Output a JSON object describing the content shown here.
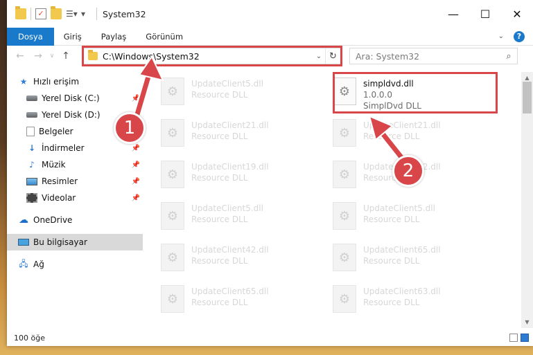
{
  "window": {
    "title": "System32",
    "controls": {
      "minimize": "—",
      "maximize": "☐",
      "close": "✕"
    }
  },
  "ribbon": {
    "tabs": [
      "Dosya",
      "Giriş",
      "Paylaş",
      "Görünüm"
    ],
    "help": "?"
  },
  "nav": {
    "address": "C:\\Windows\\System32",
    "search_placeholder": "Ara: System32"
  },
  "sidebar": {
    "items": [
      {
        "label": "Hızlı erişim",
        "icon": "star-icon"
      },
      {
        "label": "Yerel Disk (C:)",
        "icon": "disk-icon"
      },
      {
        "label": "Yerel Disk (D:)",
        "icon": "disk-icon"
      },
      {
        "label": "Belgeler",
        "icon": "documents-icon"
      },
      {
        "label": "İndirmeler",
        "icon": "downloads-icon"
      },
      {
        "label": "Müzik",
        "icon": "music-icon"
      },
      {
        "label": "Resimler",
        "icon": "pictures-icon"
      },
      {
        "label": "Videolar",
        "icon": "videos-icon"
      },
      {
        "label": "OneDrive",
        "icon": "cloud-icon"
      },
      {
        "label": "Bu bilgisayar",
        "icon": "computer-icon"
      },
      {
        "label": "Ağ",
        "icon": "network-icon"
      }
    ]
  },
  "files": [
    {
      "name": "UpdateClient5.dll",
      "sub": "Resource DLL"
    },
    {
      "name": "simpldvd.dll",
      "sub": "1.0.0.0",
      "sub2": "SimplDvd DLL"
    },
    {
      "name": "UpdateClient21.dll",
      "sub": "Resource DLL"
    },
    {
      "name": "UpdateClient21.dll",
      "sub": "Resource DLL"
    },
    {
      "name": "UpdateClient19.dll",
      "sub": "Resource DLL"
    },
    {
      "name": "UpdateClient42.dll",
      "sub": "Resource DLL"
    },
    {
      "name": "UpdateClient5.dll",
      "sub": "Resource DLL"
    },
    {
      "name": "UpdateClient5.dll",
      "sub": "Resource DLL"
    },
    {
      "name": "UpdateClient42.dll",
      "sub": "Resource DLL"
    },
    {
      "name": "UpdateClient65.dll",
      "sub": "Resource DLL"
    },
    {
      "name": "UpdateClient65.dll",
      "sub": "Resource DLL"
    },
    {
      "name": "UpdateClient63.dll",
      "sub": "Resource DLL"
    }
  ],
  "status": {
    "count": "100 öğe"
  },
  "annotations": {
    "step1": "1",
    "step2": "2"
  },
  "colors": {
    "accent": "#1979ca",
    "highlight": "#d9464a"
  }
}
